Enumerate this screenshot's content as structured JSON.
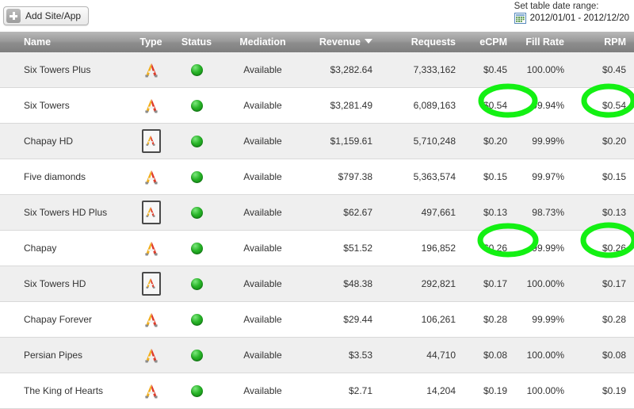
{
  "toolbar": {
    "add_site_label": "Add Site/App",
    "plus_icon": "plus-icon"
  },
  "date_range": {
    "title": "Set table date range:",
    "value": "2012/01/01 - 2012/12/20",
    "icon": "calendar-icon"
  },
  "table": {
    "columns": [
      {
        "key": "name",
        "label": "Name"
      },
      {
        "key": "type",
        "label": "Type"
      },
      {
        "key": "status",
        "label": "Status"
      },
      {
        "key": "mediation",
        "label": "Mediation"
      },
      {
        "key": "revenue",
        "label": "Revenue",
        "sorted": true,
        "sort_dir": "desc"
      },
      {
        "key": "requests",
        "label": "Requests"
      },
      {
        "key": "ecpm",
        "label": "eCPM"
      },
      {
        "key": "fill_rate",
        "label": "Fill Rate"
      },
      {
        "key": "rpm",
        "label": "RPM"
      }
    ],
    "rows": [
      {
        "name": "Six Towers Plus",
        "type": "phone-app-icon",
        "status": "available",
        "mediation": "Available",
        "revenue": "$3,282.64",
        "requests": "7,333,162",
        "ecpm": "$0.45",
        "fill_rate": "100.00%",
        "rpm": "$0.45"
      },
      {
        "name": "Six Towers",
        "type": "phone-app-icon",
        "status": "available",
        "mediation": "Available",
        "revenue": "$3,281.49",
        "requests": "6,089,163",
        "ecpm": "$0.54",
        "fill_rate": "99.94%",
        "rpm": "$0.54"
      },
      {
        "name": "Chapay HD",
        "type": "tablet-app-icon",
        "status": "available",
        "mediation": "Available",
        "revenue": "$1,159.61",
        "requests": "5,710,248",
        "ecpm": "$0.20",
        "fill_rate": "99.99%",
        "rpm": "$0.20"
      },
      {
        "name": "Five diamonds",
        "type": "phone-app-icon",
        "status": "available",
        "mediation": "Available",
        "revenue": "$797.38",
        "requests": "5,363,574",
        "ecpm": "$0.15",
        "fill_rate": "99.97%",
        "rpm": "$0.15"
      },
      {
        "name": "Six Towers HD Plus",
        "type": "tablet-app-icon",
        "status": "available",
        "mediation": "Available",
        "revenue": "$62.67",
        "requests": "497,661",
        "ecpm": "$0.13",
        "fill_rate": "98.73%",
        "rpm": "$0.13"
      },
      {
        "name": "Chapay",
        "type": "phone-app-icon",
        "status": "available",
        "mediation": "Available",
        "revenue": "$51.52",
        "requests": "196,852",
        "ecpm": "$0.26",
        "fill_rate": "99.99%",
        "rpm": "$0.26"
      },
      {
        "name": "Six Towers HD",
        "type": "tablet-app-icon",
        "status": "available",
        "mediation": "Available",
        "revenue": "$48.38",
        "requests": "292,821",
        "ecpm": "$0.17",
        "fill_rate": "100.00%",
        "rpm": "$0.17"
      },
      {
        "name": "Chapay Forever",
        "type": "phone-app-icon",
        "status": "available",
        "mediation": "Available",
        "revenue": "$29.44",
        "requests": "106,261",
        "ecpm": "$0.28",
        "fill_rate": "99.99%",
        "rpm": "$0.28"
      },
      {
        "name": "Persian Pipes",
        "type": "phone-app-icon",
        "status": "available",
        "mediation": "Available",
        "revenue": "$3.53",
        "requests": "44,710",
        "ecpm": "$0.08",
        "fill_rate": "100.00%",
        "rpm": "$0.08"
      },
      {
        "name": "The King of Hearts",
        "type": "phone-app-icon",
        "status": "available",
        "mediation": "Available",
        "revenue": "$2.71",
        "requests": "14,204",
        "ecpm": "$0.19",
        "fill_rate": "100.00%",
        "rpm": "$0.19"
      }
    ]
  },
  "annotations": {
    "color": "#13f013",
    "marks": [
      {
        "target_row": "Six Towers",
        "target_column": "eCPM",
        "shape": "ellipse"
      },
      {
        "target_row": "Six Towers",
        "target_column": "RPM",
        "shape": "ellipse"
      },
      {
        "target_row": "Chapay",
        "target_column": "eCPM",
        "shape": "ellipse"
      },
      {
        "target_row": "Chapay",
        "target_column": "RPM",
        "shape": "ellipse"
      }
    ]
  }
}
